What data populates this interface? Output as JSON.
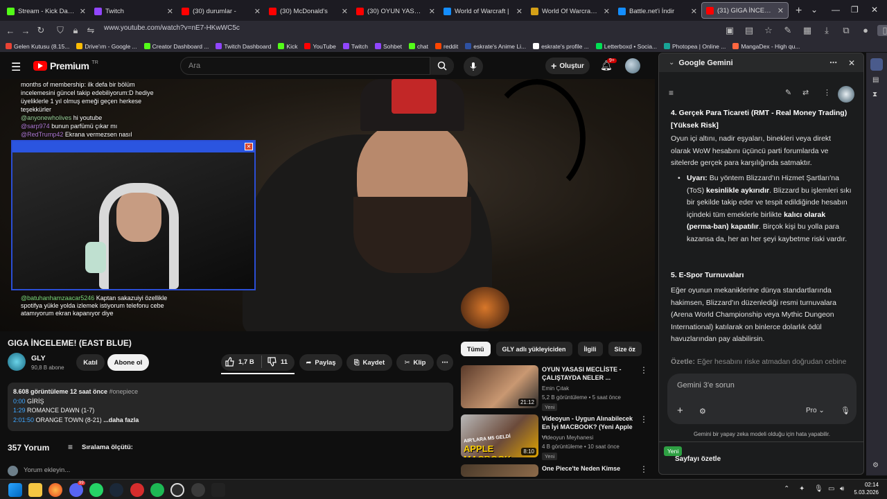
{
  "browser": {
    "tabs": [
      {
        "title": "Stream - Kick Dashb",
        "color": "#53fc18"
      },
      {
        "title": "Twitch",
        "color": "#9146ff"
      },
      {
        "title": "(30) durumlar -",
        "color": "#ff0000"
      },
      {
        "title": "(30) McDonald's",
        "color": "#ff0000"
      },
      {
        "title": "(30) OYUN YASASI",
        "color": "#ff0000"
      },
      {
        "title": "World of Warcraft |",
        "color": "#148eff"
      },
      {
        "title": "World Of Warcraft Gü",
        "color": "#d4a017"
      },
      {
        "title": "Battle.net'i İndir",
        "color": "#148eff"
      },
      {
        "title": "(31) GIGA İNCELEME!",
        "color": "#ff0000"
      }
    ],
    "url": "www.youtube.com/watch?v=nE7-HKwWC5c",
    "bookmarks": [
      {
        "label": "Gelen Kutusu (8.15...",
        "color": "#ea4335"
      },
      {
        "label": "Drive'ım - Google ...",
        "color": "#fbbc04"
      },
      {
        "label": "Creator Dashboard ...",
        "color": "#53fc18"
      },
      {
        "label": "Twitch Dashboard",
        "color": "#9146ff"
      },
      {
        "label": "Kick",
        "color": "#53fc18"
      },
      {
        "label": "YouTube",
        "color": "#ff0000"
      },
      {
        "label": "Twitch",
        "color": "#9146ff"
      },
      {
        "label": "Sohbet",
        "color": "#9146ff"
      },
      {
        "label": "chat",
        "color": "#53fc18"
      },
      {
        "label": "reddit",
        "color": "#ff4500"
      },
      {
        "label": "eskrate's Anime Li...",
        "color": "#2e51a2"
      },
      {
        "label": "eskrate's profile ...",
        "color": "#ffffff"
      },
      {
        "label": "Letterboxd • Socia...",
        "color": "#00e054"
      },
      {
        "label": "Photopea | Online ...",
        "color": "#18a497"
      },
      {
        "label": "MangaDex - High qu...",
        "color": "#ff6740"
      }
    ]
  },
  "youtube": {
    "logo": "Premium",
    "logo_sup": "TR",
    "search_placeholder": "Ara",
    "create_label": "Oluştur",
    "notif_count": "9+",
    "video": {
      "chat_top": [
        {
          "user": "",
          "text": "months of membership: ilk defa bir bölüm incelemesini güncel takip edebiliyorum:D hediye üyeliklerle 1 yıl olmuş emeği geçen herkese teşekkürler"
        },
        {
          "user": "@anyonewholives",
          "text": "hi youtube"
        },
        {
          "user": "@sarp974",
          "text": "bunun parfümü çıkar mı"
        },
        {
          "user": "@RedTrump42",
          "text": "Ekrana vermezsen nasıl"
        }
      ],
      "chat_bottom": {
        "user": "@batuhanhamzaacar5246",
        "text": "Kaptan sakazuiyi özellikle spotifya yükle yolda izlemek istiyorum telefonu cebe atamıyorum ekran kapanıyor diye"
      }
    },
    "title": "GIGA İNCELEME! (EAST BLUE)",
    "channel": {
      "name": "GLY",
      "subs": "90,8 B abone"
    },
    "join_label": "Katıl",
    "subscribed_label": "Abone ol",
    "likes": "1,7 B",
    "dislikes": "11",
    "share_label": "Paylaş",
    "save_label": "Kaydet",
    "clip_label": "Klip",
    "description": {
      "stats": "8.608 görüntüleme  12 saat önce",
      "tag": "#onepiece",
      "chapters": [
        {
          "time": "0:00",
          "label": "GİRİŞ"
        },
        {
          "time": "1:29",
          "label": "ROMANCE DAWN (1-7)"
        },
        {
          "time": "2:01:50",
          "label": "ORANGE TOWN (8-21)"
        }
      ],
      "more": "...daha fazla"
    },
    "comments_count": "357 Yorum",
    "sort_label": "Sıralama ölçütü:",
    "comment_placeholder": "Yorum ekleyin...",
    "chips": [
      "Tümü",
      "GLY adlı yükleyiciden",
      "İlgili",
      "Size öz"
    ],
    "recommendations": [
      {
        "title": "OYUN YASASI MECLİSTE - ÇALIŞTAYDA NELER ...",
        "channel": "Emin Çıtak",
        "meta": "5,2 B görüntüleme • 5 saat önce",
        "duration": "21:12",
        "badge": "Yeni"
      },
      {
        "title": "Videoyun - Uygun Alınabilecek En İyi MACBOOK? (Yeni Apple ...",
        "channel": "Videoyun Meyhanesi",
        "meta": "4 B görüntüleme • 10 saat önce",
        "duration": "8:10",
        "badge": "Yeni"
      },
      {
        "title": "One Piece'te Neden Kimse",
        "channel": "",
        "meta": "",
        "duration": "",
        "badge": ""
      }
    ],
    "thumb_text": "AIR'LARA M5 GELDİ",
    "thumb_text2": "APPLE MACBOOK"
  },
  "gemini": {
    "title": "Google Gemini",
    "section4_title": "4. Gerçek Para Ticareti (RMT - Real Money Trading) [Yüksek Risk]",
    "section4_body": "Oyun içi altını, nadir eşyaları, binekleri veya direkt olarak WoW hesabını üçüncü parti forumlarda ve sitelerde gerçek para karşılığında satmaktır.",
    "warn_label": "Uyarı:",
    "warn_text1": "Bu yöntem Blizzard'ın Hizmet Şartları'na (ToS)",
    "warn_bold1": "kesinlikle aykırıdır",
    "warn_text2": ". Blizzard bu işlemleri sıkı bir şekilde takip eder ve tespit edildiğinde hesabın içindeki tüm emeklerle birlikte",
    "warn_bold2": "kalıcı olarak (perma-ban) kapatılır",
    "warn_text3": ". Birçok kişi bu yolla para kazansa da, her an her şeyi kaybetme riski vardır.",
    "section5_title": "5. E-Spor Turnuvaları",
    "section5_body": "Eğer oyunun mekaniklerine dünya standartlarında hakimsen, Blizzard'ın düzenlediği resmi turnuvalara (Arena World Championship veya Mythic Dungeon International) katılarak on binlerce dolarlık ödül havuzlarından pay alabilirsin.",
    "summary_label": "Özetle:",
    "summary_text": "Eğer hesabını riske atmadan doğrudan cebine",
    "input_placeholder": "Gemini 3'e sorun",
    "mode_label": "Pro",
    "disclaimer": "Gemini bir yapay zeka modeli olduğu için hata yapabilir.",
    "new_badge": "Yeni",
    "summarize_label": "Sayfayı özetle"
  },
  "taskbar": {
    "time": "02:14",
    "date": "5.03.2026",
    "discord_badge": "99"
  }
}
